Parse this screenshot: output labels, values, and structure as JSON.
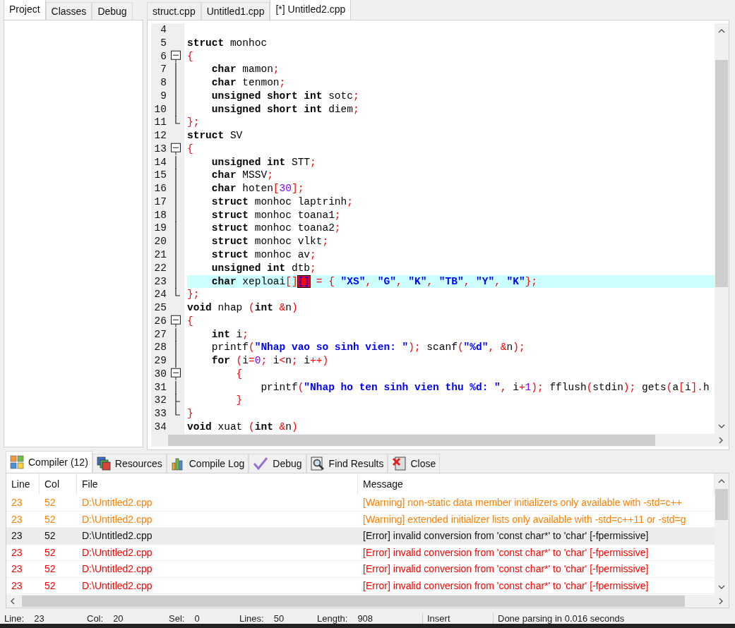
{
  "left_tabs": [
    {
      "label": "Project",
      "selected": true
    },
    {
      "label": "Classes",
      "selected": false
    },
    {
      "label": "Debug",
      "selected": false
    }
  ],
  "editor_tabs": [
    {
      "label": "struct.cpp",
      "selected": false
    },
    {
      "label": "Untitled1.cpp",
      "selected": false
    },
    {
      "label": "[*] Untitled2.cpp",
      "selected": true
    }
  ],
  "code_lines": [
    {
      "number": "4"
    },
    {
      "number": "5",
      "tokens": [
        {
          "kind": "kw",
          "text": "struct"
        },
        {
          "kind": "id",
          "text": " monhoc"
        }
      ]
    },
    {
      "number": "6",
      "kind": "box",
      "tokens": [
        {
          "kind": "sym",
          "text": "{"
        }
      ]
    },
    {
      "number": "7",
      "kind": "bar",
      "tokens": [
        {
          "kind": "kw",
          "text": "    char"
        },
        {
          "kind": "id",
          "text": " mamon"
        },
        {
          "kind": "sym",
          "text": ";"
        }
      ]
    },
    {
      "number": "8",
      "kind": "bar",
      "tokens": [
        {
          "kind": "kw",
          "text": "    char"
        },
        {
          "kind": "id",
          "text": " tenmon"
        },
        {
          "kind": "sym",
          "text": ";"
        }
      ]
    },
    {
      "number": "9",
      "kind": "bar",
      "tokens": [
        {
          "kind": "kw",
          "text": "    unsigned short int"
        },
        {
          "kind": "id",
          "text": " sotc"
        },
        {
          "kind": "sym",
          "text": ";"
        }
      ]
    },
    {
      "number": "10",
      "kind": "bar",
      "tokens": [
        {
          "kind": "kw",
          "text": "    unsigned short int"
        },
        {
          "kind": "id",
          "text": " diem"
        },
        {
          "kind": "sym",
          "text": ";"
        }
      ]
    },
    {
      "number": "11",
      "kind": "end",
      "tokens": [
        {
          "kind": "sym",
          "text": "};"
        }
      ]
    },
    {
      "number": "12",
      "tokens": [
        {
          "kind": "kw",
          "text": "struct"
        },
        {
          "kind": "id",
          "text": " SV"
        }
      ]
    },
    {
      "number": "13",
      "kind": "box",
      "tokens": [
        {
          "kind": "sym",
          "text": "{"
        }
      ]
    },
    {
      "number": "14",
      "kind": "bar",
      "tokens": [
        {
          "kind": "kw",
          "text": "    unsigned int"
        },
        {
          "kind": "id",
          "text": " STT"
        },
        {
          "kind": "sym",
          "text": ";"
        }
      ]
    },
    {
      "number": "15",
      "kind": "bar",
      "tokens": [
        {
          "kind": "kw",
          "text": "    char"
        },
        {
          "kind": "id",
          "text": " MSSV"
        },
        {
          "kind": "sym",
          "text": ";"
        }
      ]
    },
    {
      "number": "16",
      "kind": "bar",
      "tokens": [
        {
          "kind": "kw",
          "text": "    char"
        },
        {
          "kind": "id",
          "text": " hoten"
        },
        {
          "kind": "sym",
          "text": "["
        },
        {
          "kind": "num",
          "text": "30"
        },
        {
          "kind": "sym",
          "text": "];"
        }
      ]
    },
    {
      "number": "17",
      "kind": "bar",
      "tokens": [
        {
          "kind": "kw",
          "text": "    struct"
        },
        {
          "kind": "id",
          "text": " monhoc laptrinh"
        },
        {
          "kind": "sym",
          "text": ";"
        }
      ]
    },
    {
      "number": "18",
      "kind": "bar",
      "tokens": [
        {
          "kind": "kw",
          "text": "    struct"
        },
        {
          "kind": "id",
          "text": " monhoc toana1"
        },
        {
          "kind": "sym",
          "text": ";"
        }
      ]
    },
    {
      "number": "19",
      "kind": "bar",
      "tokens": [
        {
          "kind": "kw",
          "text": "    struct"
        },
        {
          "kind": "id",
          "text": " monhoc toana2"
        },
        {
          "kind": "sym",
          "text": ";"
        }
      ]
    },
    {
      "number": "20",
      "kind": "bar",
      "tokens": [
        {
          "kind": "kw",
          "text": "    struct"
        },
        {
          "kind": "id",
          "text": " monhoc vlkt"
        },
        {
          "kind": "sym",
          "text": ";"
        }
      ]
    },
    {
      "number": "21",
      "kind": "bar",
      "tokens": [
        {
          "kind": "kw",
          "text": "    struct"
        },
        {
          "kind": "id",
          "text": " monhoc av"
        },
        {
          "kind": "sym",
          "text": ";"
        }
      ]
    },
    {
      "number": "22",
      "kind": "bar",
      "tokens": [
        {
          "kind": "kw",
          "text": "    unsigned int"
        },
        {
          "kind": "id",
          "text": " dtb"
        },
        {
          "kind": "sym",
          "text": ";"
        }
      ]
    },
    {
      "number": "23",
      "kind": "bar",
      "current": true,
      "tokens": [
        {
          "kind": "kw",
          "text": "    char"
        },
        {
          "kind": "id",
          "text": " xeploai"
        },
        {
          "kind": "sym",
          "text": "[]"
        },
        {
          "kind": "match",
          "text": "[]"
        },
        {
          "kind": "sym",
          "text": " = { "
        },
        {
          "kind": "str",
          "text": "\"XS\""
        },
        {
          "kind": "sym",
          "text": ", "
        },
        {
          "kind": "str",
          "text": "\"G\""
        },
        {
          "kind": "sym",
          "text": ", "
        },
        {
          "kind": "str",
          "text": "\"K\""
        },
        {
          "kind": "sym",
          "text": ", "
        },
        {
          "kind": "str",
          "text": "\"TB\""
        },
        {
          "kind": "sym",
          "text": ", "
        },
        {
          "kind": "str",
          "text": "\"Y\""
        },
        {
          "kind": "sym",
          "text": ", "
        },
        {
          "kind": "str",
          "text": "\"K\""
        },
        {
          "kind": "sym",
          "text": "};"
        }
      ]
    },
    {
      "number": "24",
      "kind": "end",
      "tokens": [
        {
          "kind": "sym",
          "text": "};"
        }
      ]
    },
    {
      "number": "25",
      "tokens": [
        {
          "kind": "kw",
          "text": "void"
        },
        {
          "kind": "id",
          "text": " nhap "
        },
        {
          "kind": "sym",
          "text": "("
        },
        {
          "kind": "kw",
          "text": "int"
        },
        {
          "kind": "sym",
          "text": " &"
        },
        {
          "kind": "id",
          "text": "n"
        },
        {
          "kind": "sym",
          "text": ")"
        }
      ]
    },
    {
      "number": "26",
      "kind": "box",
      "tokens": [
        {
          "kind": "sym",
          "text": "{"
        }
      ]
    },
    {
      "number": "27",
      "kind": "bar",
      "tokens": [
        {
          "kind": "kw",
          "text": "    int"
        },
        {
          "kind": "id",
          "text": " i"
        },
        {
          "kind": "sym",
          "text": ";"
        }
      ]
    },
    {
      "number": "28",
      "kind": "bar",
      "tokens": [
        {
          "kind": "id",
          "text": "    printf"
        },
        {
          "kind": "sym",
          "text": "("
        },
        {
          "kind": "str",
          "text": "\"Nhap vao so sinh vien: \""
        },
        {
          "kind": "sym",
          "text": ");"
        },
        {
          "kind": "id",
          "text": " scanf"
        },
        {
          "kind": "sym",
          "text": "("
        },
        {
          "kind": "str",
          "text": "\"%d\""
        },
        {
          "kind": "sym",
          "text": ", &"
        },
        {
          "kind": "id",
          "text": "n"
        },
        {
          "kind": "sym",
          "text": ");"
        }
      ]
    },
    {
      "number": "29",
      "kind": "bar",
      "tokens": [
        {
          "kind": "kw",
          "text": "    for"
        },
        {
          "kind": "sym",
          "text": " ("
        },
        {
          "kind": "id",
          "text": "i"
        },
        {
          "kind": "sym",
          "text": "="
        },
        {
          "kind": "num",
          "text": "0"
        },
        {
          "kind": "sym",
          "text": ";"
        },
        {
          "kind": "id",
          "text": " i"
        },
        {
          "kind": "sym",
          "text": "<"
        },
        {
          "kind": "id",
          "text": "n"
        },
        {
          "kind": "sym",
          "text": ";"
        },
        {
          "kind": "id",
          "text": " i"
        },
        {
          "kind": "sym",
          "text": "++)"
        }
      ]
    },
    {
      "number": "30",
      "kind": "box",
      "tokens": [
        {
          "kind": "sym",
          "text": "        {"
        }
      ]
    },
    {
      "number": "31",
      "kind": "bar",
      "tokens": [
        {
          "kind": "id",
          "text": "            printf"
        },
        {
          "kind": "sym",
          "text": "("
        },
        {
          "kind": "str",
          "text": "\"Nhap ho ten sinh vien thu %d: \""
        },
        {
          "kind": "sym",
          "text": ", "
        },
        {
          "kind": "id",
          "text": "i"
        },
        {
          "kind": "sym",
          "text": "+"
        },
        {
          "kind": "num",
          "text": "1"
        },
        {
          "kind": "sym",
          "text": ");"
        },
        {
          "kind": "id",
          "text": " fflush"
        },
        {
          "kind": "sym",
          "text": "("
        },
        {
          "kind": "id",
          "text": "stdin"
        },
        {
          "kind": "sym",
          "text": ");"
        },
        {
          "kind": "id",
          "text": " gets"
        },
        {
          "kind": "sym",
          "text": "("
        },
        {
          "kind": "id",
          "text": "a"
        },
        {
          "kind": "sym",
          "text": "["
        },
        {
          "kind": "id",
          "text": "i"
        },
        {
          "kind": "sym",
          "text": "]."
        },
        {
          "kind": "id",
          "text": "h"
        }
      ]
    },
    {
      "number": "32",
      "kind": "tee",
      "tokens": [
        {
          "kind": "sym",
          "text": "        }"
        }
      ]
    },
    {
      "number": "33",
      "kind": "end",
      "tokens": [
        {
          "kind": "sym",
          "text": "}"
        }
      ]
    },
    {
      "number": "34",
      "tokens": [
        {
          "kind": "kw",
          "text": "void"
        },
        {
          "kind": "id",
          "text": " xuat "
        },
        {
          "kind": "sym",
          "text": "("
        },
        {
          "kind": "kw",
          "text": "int"
        },
        {
          "kind": "sym",
          "text": " &"
        },
        {
          "kind": "id",
          "text": "n"
        },
        {
          "kind": "sym",
          "text": ")"
        }
      ]
    }
  ],
  "bottom_tabs": [
    {
      "label": "Compiler (12)",
      "selected": true
    },
    {
      "label": "Resources",
      "selected": false
    },
    {
      "label": "Compile Log",
      "selected": false
    },
    {
      "label": "Debug",
      "selected": false
    },
    {
      "label": "Find Results",
      "selected": false
    },
    {
      "label": "Close",
      "selected": false
    }
  ],
  "table": {
    "columns": [
      "Line",
      "Col",
      "File",
      "Message"
    ],
    "rows": [
      {
        "kind": "warning",
        "selected": false,
        "cells": [
          "23",
          "52",
          "D:\\Untitled2.cpp",
          "[Warning] non-static data member initializers only available with -std=c++"
        ]
      },
      {
        "kind": "warning",
        "selected": false,
        "cells": [
          "23",
          "52",
          "D:\\Untitled2.cpp",
          "[Warning] extended initializer lists only available with -std=c++11 or -std=g"
        ]
      },
      {
        "kind": "error",
        "selected": true,
        "cells": [
          "23",
          "52",
          "D:\\Untitled2.cpp",
          "[Error] invalid conversion from 'const char*' to 'char' [-fpermissive]"
        ]
      },
      {
        "kind": "error",
        "selected": false,
        "cells": [
          "23",
          "52",
          "D:\\Untitled2.cpp",
          "[Error] invalid conversion from 'const char*' to 'char' [-fpermissive]"
        ]
      },
      {
        "kind": "error",
        "selected": false,
        "cells": [
          "23",
          "52",
          "D:\\Untitled2.cpp",
          "[Error] invalid conversion from 'const char*' to 'char' [-fpermissive]"
        ]
      },
      {
        "kind": "error",
        "selected": false,
        "cells": [
          "23",
          "52",
          "D:\\Untitled2.cpp",
          "[Error] invalid conversion from 'const char*' to 'char' [-fpermissive]"
        ]
      }
    ]
  },
  "status_bar": [
    {
      "label": "Line:",
      "value": "23"
    },
    {
      "label": "Col:",
      "value": "20"
    },
    {
      "label": "Sel:",
      "value": "0"
    },
    {
      "label": "Lines:",
      "value": "50"
    },
    {
      "label": "Length:",
      "value": "908"
    },
    {
      "label": "Insert"
    },
    {
      "label": "Done parsing in 0.016 seconds"
    }
  ]
}
